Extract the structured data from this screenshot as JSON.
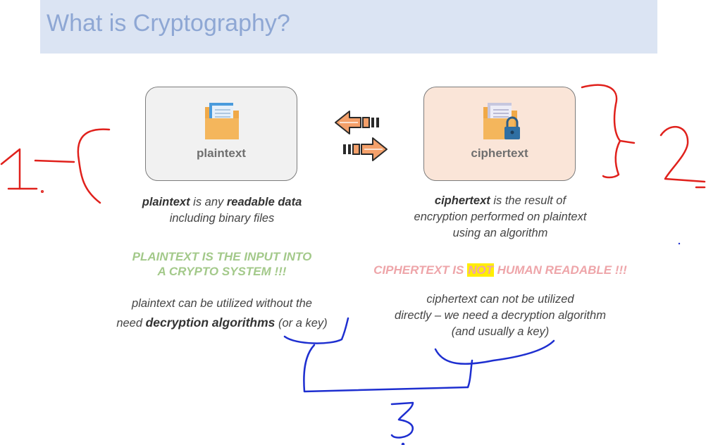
{
  "slide": {
    "title": "What is Cryptography?"
  },
  "plaintext_card": {
    "label": "plaintext",
    "icon": "folder-document-icon"
  },
  "ciphertext_card": {
    "label": "ciphertext",
    "icon": "locked-folder-icon"
  },
  "arrows": {
    "left": "arrow-left-icon",
    "right": "arrow-right-icon"
  },
  "plaintext_text": {
    "def_term": "plaintext",
    "def_mid": " is any ",
    "def_emph": "readable data",
    "def_line2": "including binary files",
    "caps_line1": "PLAINTEXT IS THE INPUT INTO",
    "caps_line2": "A CRYPTO SYSTEM !!!",
    "note_line1": "plaintext can be utilized without the",
    "note_line2_pre": "need ",
    "note_line2_emph": "decryption algorithms",
    "note_line2_post": " (or a key)"
  },
  "ciphertext_text": {
    "def_term": "ciphertext",
    "def_line1_post": " is the result of",
    "def_line2": "encryption performed on plaintext",
    "def_line3": "using an algorithm",
    "caps_pre": "CIPHERTEXT IS ",
    "caps_hl": "NOT",
    "caps_post": " HUMAN READABLE !!!",
    "note_line1": "ciphertext can not be utilized",
    "note_line2": "directly – we need a decryption algorithm",
    "note_line3": "(and usually a key)"
  },
  "annotations": {
    "one": "1",
    "two": "2",
    "three": "3",
    "red": "#e0211c",
    "blue": "#1e2fd0"
  }
}
